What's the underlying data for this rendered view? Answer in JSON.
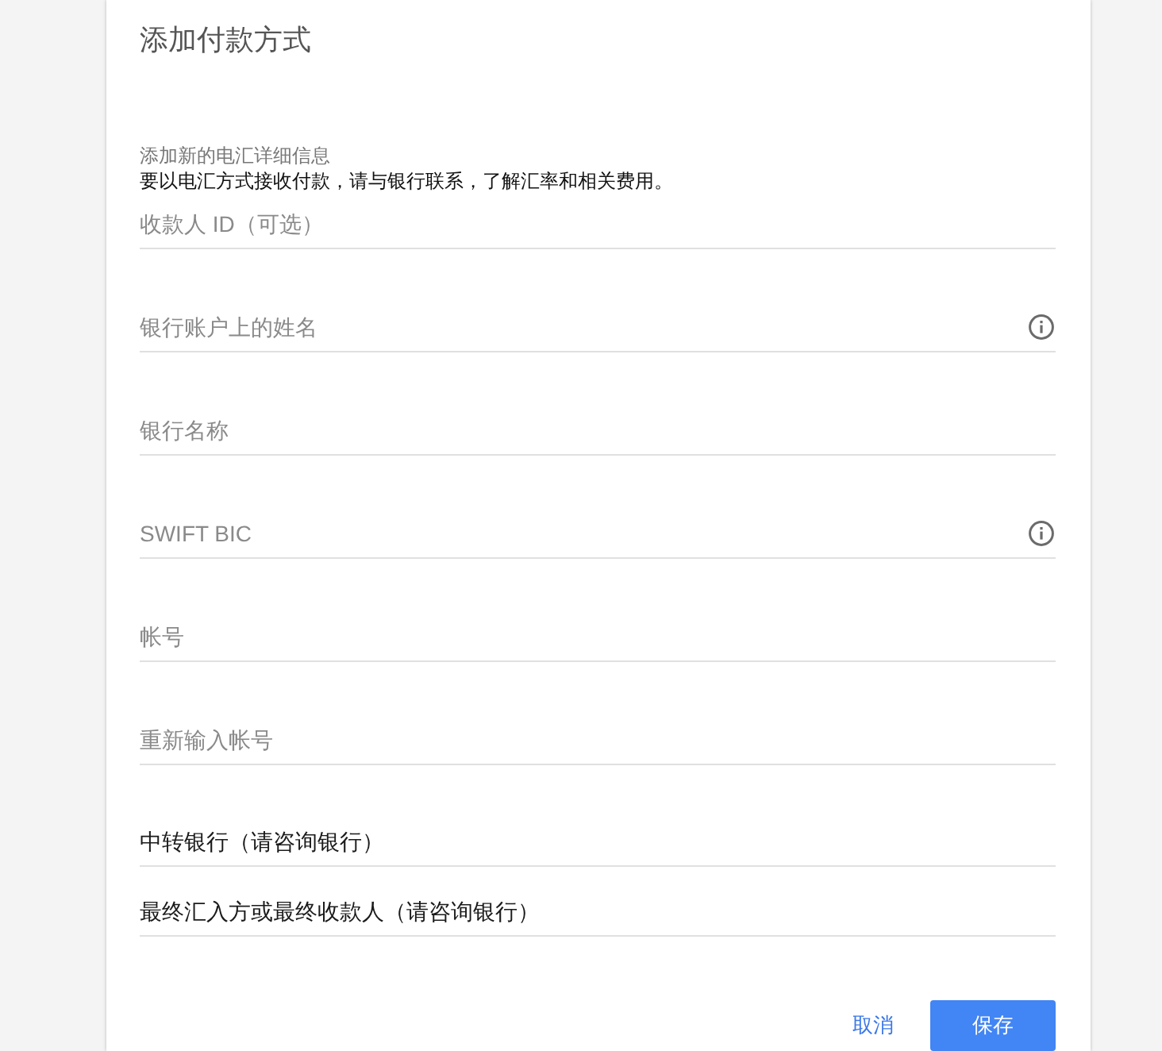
{
  "dialog": {
    "title": "添加付款方式",
    "subtitle": "添加新的电汇详细信息",
    "instruction": "要以电汇方式接收付款，请与银行联系，了解汇率和相关费用。"
  },
  "fields": [
    {
      "kind": "input",
      "placeholder": "收款人 ID（可选）",
      "info": false
    },
    {
      "kind": "input",
      "placeholder": "银行账户上的姓名",
      "info": true
    },
    {
      "kind": "input",
      "placeholder": "银行名称",
      "info": false
    },
    {
      "kind": "input",
      "placeholder": "SWIFT BIC",
      "info": true
    },
    {
      "kind": "input",
      "placeholder": "帐号",
      "info": false
    },
    {
      "kind": "input",
      "placeholder": "重新输入帐号",
      "info": false
    },
    {
      "kind": "textarea",
      "placeholder": "中转银行（请咨询银行）",
      "info": false
    },
    {
      "kind": "textarea",
      "placeholder": "最终汇入方或最终收款人（请咨询银行）",
      "info": false
    }
  ],
  "buttons": [
    {
      "kind": "text",
      "label": "取消"
    },
    {
      "kind": "primary",
      "label": "保存"
    }
  ]
}
